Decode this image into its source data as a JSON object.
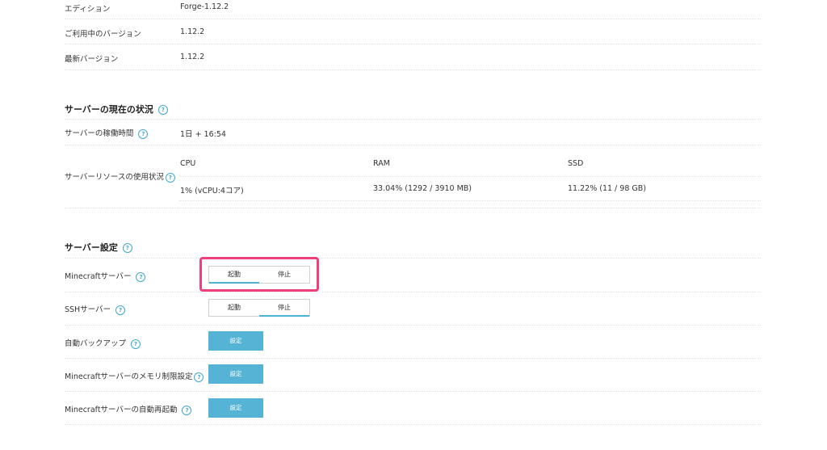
{
  "info": {
    "edition_label": "エディション",
    "edition_value": "Forge-1.12.2",
    "current_version_label": "ご利用中のバージョン",
    "current_version_value": "1.12.2",
    "latest_version_label": "最新バージョン",
    "latest_version_value": "1.12.2"
  },
  "status": {
    "title": "サーバーの現在の状況",
    "uptime_label": "サーバーの稼働時間",
    "uptime_value": "1日 + 16:54",
    "resources_label": "サーバーリソースの使用状況",
    "resources": [
      {
        "name": "CPU",
        "value": "1% (vCPU:4コア)"
      },
      {
        "name": "RAM",
        "value": "33.04% (1292 / 3910 MB)"
      },
      {
        "name": "SSD",
        "value": "11.22% (11 / 98 GB)"
      }
    ]
  },
  "settings": {
    "title": "サーバー設定",
    "minecraft_label": "Minecraftサーバー",
    "minecraft_toggle": {
      "start": "起動",
      "stop": "停止",
      "active": "start"
    },
    "ssh_label": "SSHサーバー",
    "ssh_toggle": {
      "start": "起動",
      "stop": "停止",
      "active": "stop"
    },
    "backup_label": "自動バックアップ",
    "backup_button": "設定",
    "memory_label": "Minecraftサーバーのメモリ制限設定",
    "memory_button": "設定",
    "restart_label": "Minecraftサーバーの自動再起動",
    "restart_button": "設定"
  },
  "help_glyph": "?",
  "colors": {
    "accent": "#55b4d6",
    "highlight": "#f0407a",
    "help": "#3fa8d0"
  }
}
